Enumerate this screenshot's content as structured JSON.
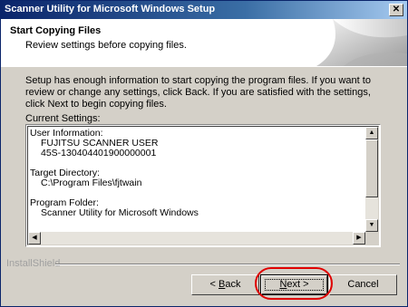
{
  "window": {
    "title": "Scanner Utility for Microsoft Windows Setup",
    "close_glyph": "✕"
  },
  "header": {
    "title": "Start Copying Files",
    "subtitle": "Review settings before copying files."
  },
  "body": {
    "instructions": "Setup has enough information to start copying the program files.  If you want to review or change any settings, click Back.  If you are satisfied with the settings, click Next to begin copying files.",
    "current_settings_label": "Current Settings:"
  },
  "settings": {
    "user_info_label": "User Information:",
    "user_name": "FUJITSU SCANNER USER",
    "serial": "45S-130404401900000001",
    "target_label": "Target Directory:",
    "target_path": "C:\\Program Files\\fjtwain",
    "folder_label": "Program Folder:",
    "folder_name": "Scanner Utility for Microsoft Windows"
  },
  "footer": {
    "brand": "InstallShield",
    "back_prefix": "< ",
    "back_hotkey": "B",
    "back_rest": "ack",
    "next_hotkey": "N",
    "next_rest": "ext >",
    "cancel_label": "Cancel"
  },
  "icons": {
    "scroll_up": "▲",
    "scroll_down": "▼",
    "scroll_left": "◀",
    "scroll_right": "▶"
  },
  "colors": {
    "title_gradient_start": "#0a246a",
    "title_gradient_end": "#a6caf0",
    "dialog_face": "#d4d0c8",
    "highlight_ring": "#e00000"
  }
}
